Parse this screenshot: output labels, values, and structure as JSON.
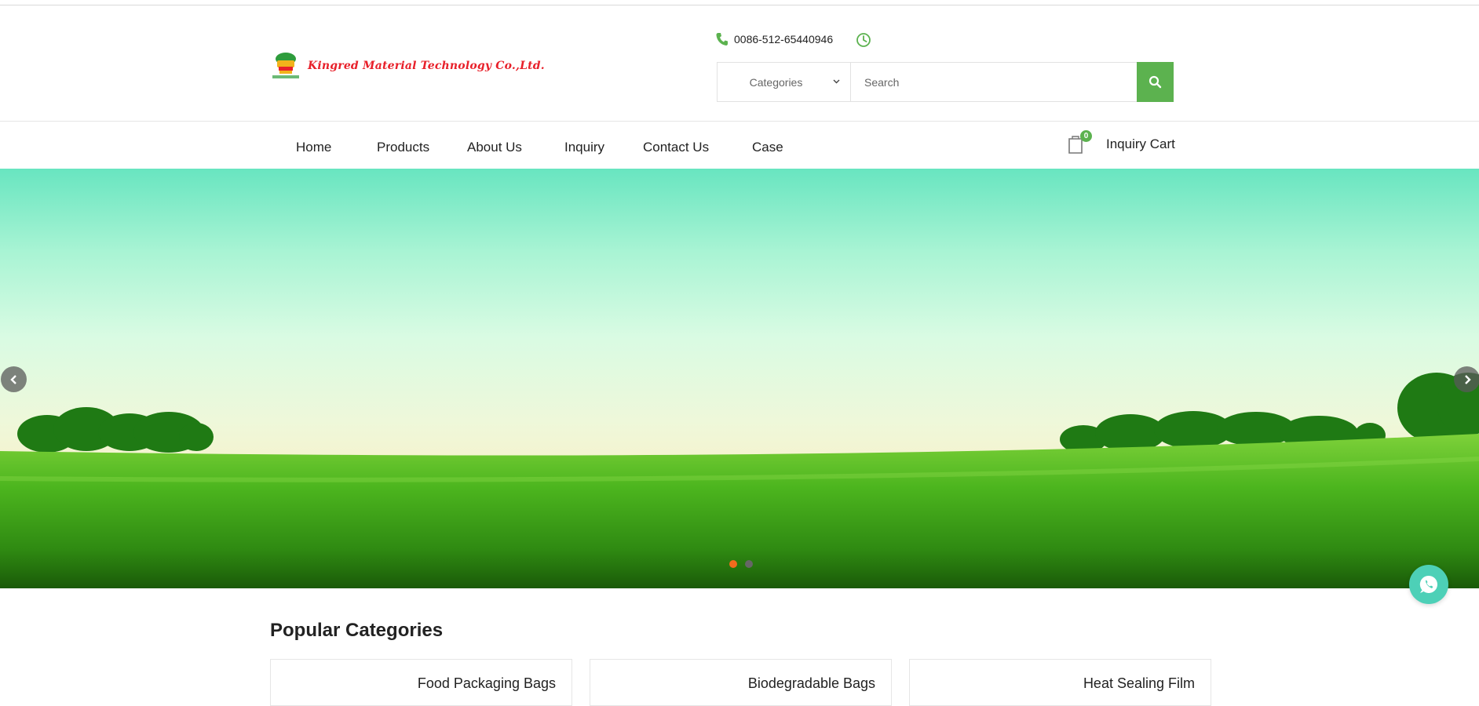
{
  "header": {
    "logo_text": "Kingred Material Technology Co.,Ltd.",
    "phone": "0086-512-65440946",
    "search": {
      "category_label": "Categories",
      "placeholder": "Search"
    }
  },
  "nav": {
    "items": [
      {
        "label": "Home"
      },
      {
        "label": "Products"
      },
      {
        "label": "About Us"
      },
      {
        "label": "Inquiry"
      },
      {
        "label": "Contact Us"
      },
      {
        "label": "Case"
      }
    ],
    "cart": {
      "count": "0",
      "label": "Inquiry Cart"
    }
  },
  "hero": {
    "slide_count": 2,
    "active_slide": 1,
    "dot_active_color": "#f26b1d",
    "dot_inactive_color": "#666666"
  },
  "popular": {
    "title": "Popular Categories",
    "categories": [
      {
        "label": "Food Packaging Bags"
      },
      {
        "label": "Biodegradable Bags"
      },
      {
        "label": "Heat Sealing Film"
      }
    ]
  },
  "colors": {
    "accent": "#5cb24f",
    "logo_red": "#e8202a",
    "whatsapp": "#4dd0b7"
  },
  "icons": [
    "phone-icon",
    "clock-icon",
    "chevron-down-icon",
    "search-icon",
    "cart-icon",
    "chevron-left-icon",
    "chevron-right-icon",
    "whatsapp-icon"
  ]
}
